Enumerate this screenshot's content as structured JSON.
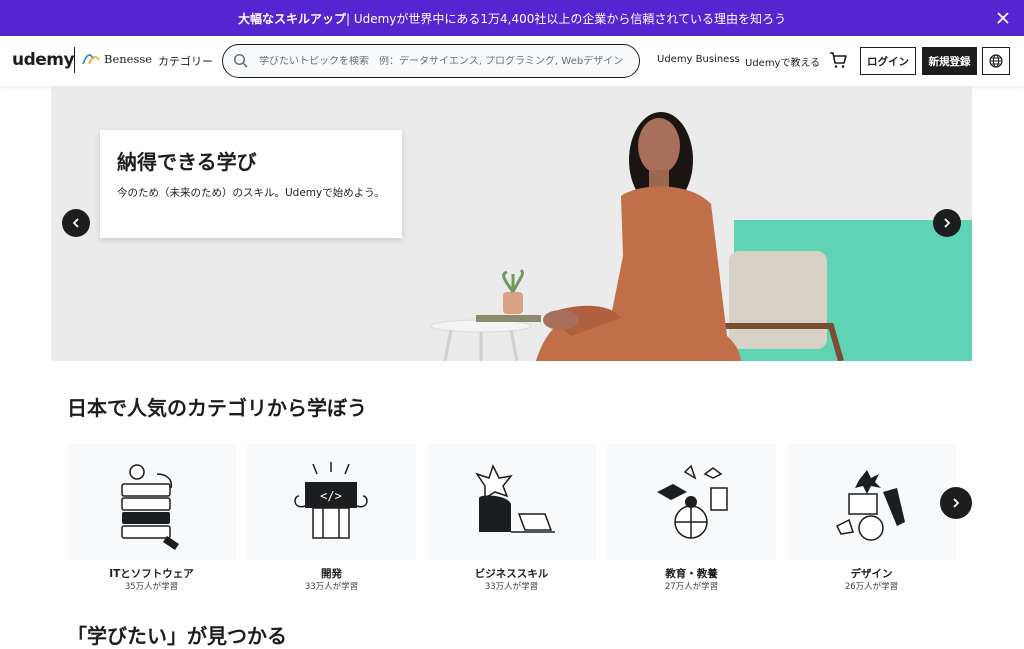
{
  "banner": {
    "bold_text": "大幅なスキルアップ",
    "text": " | Udemyが世界中にある1万4,400社以上の企業から信頼されている理由を知ろう"
  },
  "header": {
    "logo": "udemy",
    "partner": "Benesse",
    "categories": "カテゴリー",
    "search_placeholder": "学びたいトピックを検索　例：データサイエンス, プログラミング, Webデザイン",
    "business": "Udemy Business",
    "teach": "Udemyで教える",
    "login": "ログイン",
    "signup": "新規登録"
  },
  "hero": {
    "title": "納得できる学び",
    "subtitle": "今のため（未来のため）のスキル。Udemyで始めよう。"
  },
  "categories_section": {
    "title": "日本で人気のカテゴリから学ぼう",
    "items": [
      {
        "name": "ITとソフトウェア",
        "learners": "35万人が学習"
      },
      {
        "name": "開発",
        "learners": "33万人が学習"
      },
      {
        "name": "ビジネススキル",
        "learners": "33万人が学習"
      },
      {
        "name": "教育・教養",
        "learners": "27万人が学習"
      },
      {
        "name": "デザイン",
        "learners": "26万人が学習"
      }
    ]
  },
  "next_section": {
    "title": "「学びたい」が見つかる"
  },
  "colors": {
    "banner": "#5624d0",
    "brand_purple": "#a435f0",
    "hero_accent": "#5fd4b4",
    "dark": "#1c1d1f"
  }
}
